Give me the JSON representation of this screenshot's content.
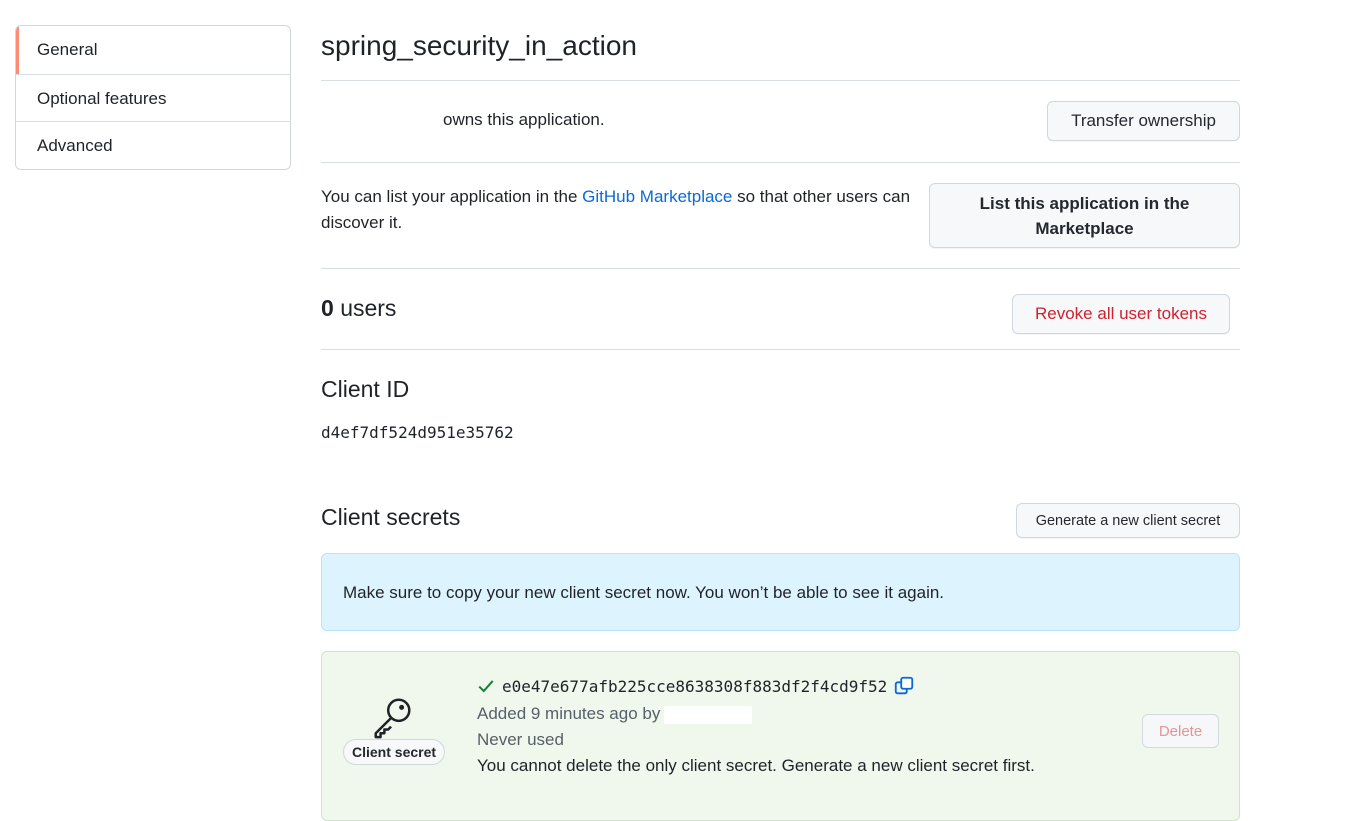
{
  "sidebar": {
    "items": [
      {
        "label": "General"
      },
      {
        "label": "Optional features"
      },
      {
        "label": "Advanced"
      }
    ]
  },
  "app": {
    "name": "spring_security_in_action"
  },
  "ownership": {
    "text": "owns this application.",
    "transfer_button": "Transfer ownership"
  },
  "marketplace": {
    "text_before": "You can list your application in the ",
    "link": "GitHub Marketplace",
    "text_after": " so that other users can discover it.",
    "button": "List this application in the Marketplace"
  },
  "users": {
    "count": "0",
    "label": "users",
    "revoke_button": "Revoke all user tokens"
  },
  "client_id": {
    "heading": "Client ID",
    "value": "d4ef7df524d951e35762"
  },
  "client_secrets": {
    "heading": "Client secrets",
    "generate_button": "Generate a new client secret",
    "notice": "Make sure to copy your new client secret now. You won’t be able to see it again.",
    "secret": {
      "badge": "Client secret",
      "value": "e0e47e677afb225cce8638308f883df2f4cd9f52",
      "added": "Added 9 minutes ago by",
      "usage": "Never used",
      "note": "You cannot delete the only client secret. Generate a new client secret first.",
      "delete_button": "Delete"
    }
  },
  "colors": {
    "accent_link": "#0969da",
    "danger": "#cf222e",
    "active_indicator": "#fd8c73",
    "info_bg": "#ddf4ff",
    "success_bg": "#f0f7ec"
  },
  "icons": [
    "key-icon",
    "check-icon",
    "copy-icon"
  ]
}
